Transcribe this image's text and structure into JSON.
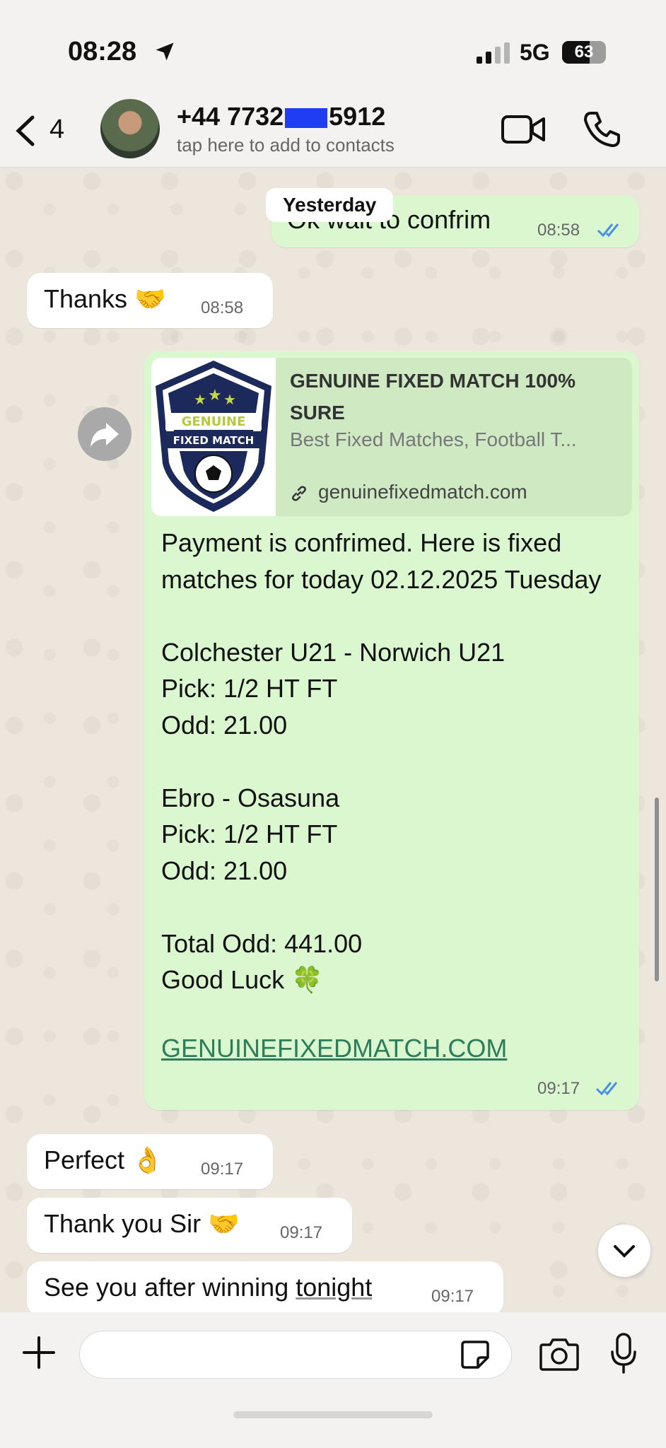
{
  "status_bar": {
    "time": "08:28",
    "network": "5G",
    "battery": "63",
    "battery_level": 0.63
  },
  "header": {
    "back_count": "4",
    "contact_name_start": "+44 7732",
    "contact_name_end": "5912",
    "subtitle": "tap here to add to contacts"
  },
  "date_separator": "Yesterday",
  "messages": {
    "m1": {
      "text": "Ok wait to confrim",
      "time": "08:58",
      "direction": "outgoing",
      "status": "read"
    },
    "m2": {
      "text": "Thanks 🤝",
      "time": "08:58",
      "direction": "incoming"
    },
    "m3": {
      "preview": {
        "title": "GENUINE FIXED MATCH 100% SURE",
        "description": "Best Fixed Matches, Football T...",
        "domain": "genuinefixedmatch.com",
        "logo_top": "GENUINE",
        "logo_bottom": "FIXED MATCH"
      },
      "body": "Payment is confrimed. Here is fixed matches for today 02.12.2025 Tuesday\n\nColchester U21 - Norwich U21\nPick: 1/2 HT FT\nOdd: 21.00\n\nEbro - Osasuna\nPick: 1/2 HT FT\nOdd: 21.00\n\nTotal Odd: 441.00\nGood Luck 🍀",
      "link": "GENUINEFIXEDMATCH.COM",
      "time": "09:17",
      "direction": "outgoing",
      "status": "read"
    },
    "m4": {
      "text": "Perfect 👌",
      "time": "09:17",
      "direction": "incoming"
    },
    "m5": {
      "text": "Thank you Sir 🤝",
      "time": "09:17",
      "direction": "incoming"
    },
    "m6": {
      "text_before": "See you after winning ",
      "text_underlined": "tonight",
      "time": "09:17",
      "direction": "incoming"
    }
  },
  "input": {
    "placeholder": ""
  },
  "colors": {
    "outgoing_bubble": "#dbf7d0",
    "incoming_bubble": "#ffffff",
    "read_ticks": "#4a90e2",
    "link": "#2e7d5a"
  },
  "icons": [
    "location-arrow-icon",
    "signal-icon",
    "back-chevron-icon",
    "video-call-icon",
    "phone-icon",
    "forward-icon",
    "link-icon",
    "read-ticks-icon",
    "chevron-down-icon",
    "plus-icon",
    "sticker-icon",
    "camera-icon",
    "mic-icon"
  ]
}
